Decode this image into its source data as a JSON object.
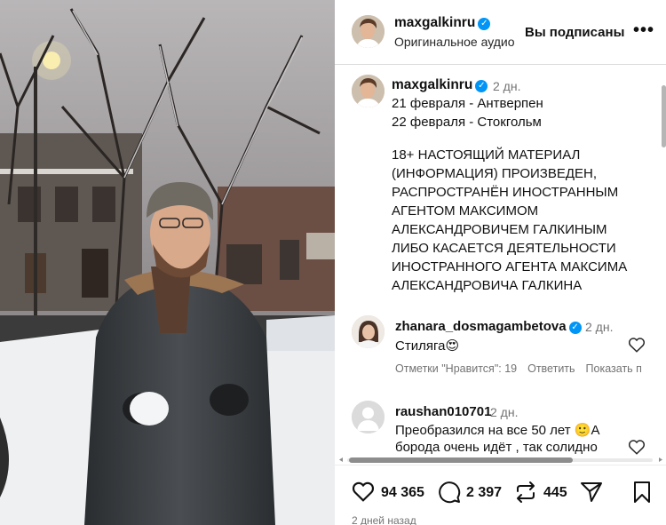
{
  "post": {
    "username": "maxgalkinru",
    "audio": "Оригинальное аудио",
    "follow_label": "Вы подписаны",
    "more_icon": "•••",
    "caption_time": "2 дн.",
    "caption_lines": [
      "21 февраля - Антверпен",
      "22 февраля - Стокгольм",
      "18+ НАСТОЯЩИЙ МАТЕРИАЛ",
      "(ИНФОРМАЦИЯ)  ПРОИЗВЕДЕН,",
      "РАСПРОСТРАНЁН ИНОСТРАННЫМ",
      "АГЕНТОМ МАКСИМОМ",
      "АЛЕКСАНДРОВИЧЕМ ГАЛКИНЫМ",
      "ЛИБО КАСАЕТСЯ ДЕЯТЕЛЬНОСТИ",
      "ИНОСТРАННОГО АГЕНТА МАКСИМА",
      "АЛЕКСАНДРОВИЧА ГАЛКИНА"
    ],
    "posted_ago": "2 дней назад"
  },
  "comments": [
    {
      "username": "zhanara_dosmagambetova",
      "verified": true,
      "time": "2 дн.",
      "text": "Стиляга😍",
      "likes_label": "Отметки \"Нравится\": 19",
      "reply_label": "Ответить",
      "show_label": "Показать п"
    },
    {
      "username": "raushan010701",
      "verified": false,
      "time": "2 дн.",
      "text_lines": [
        "Преобразился на все 50 лет 🙂А",
        "борода очень идёт , так солидно"
      ]
    }
  ],
  "actions": {
    "likes": "94 365",
    "comments": "2 397",
    "reposts": "445"
  },
  "colors": {
    "accent": "#0095f6",
    "muted": "#737373"
  }
}
